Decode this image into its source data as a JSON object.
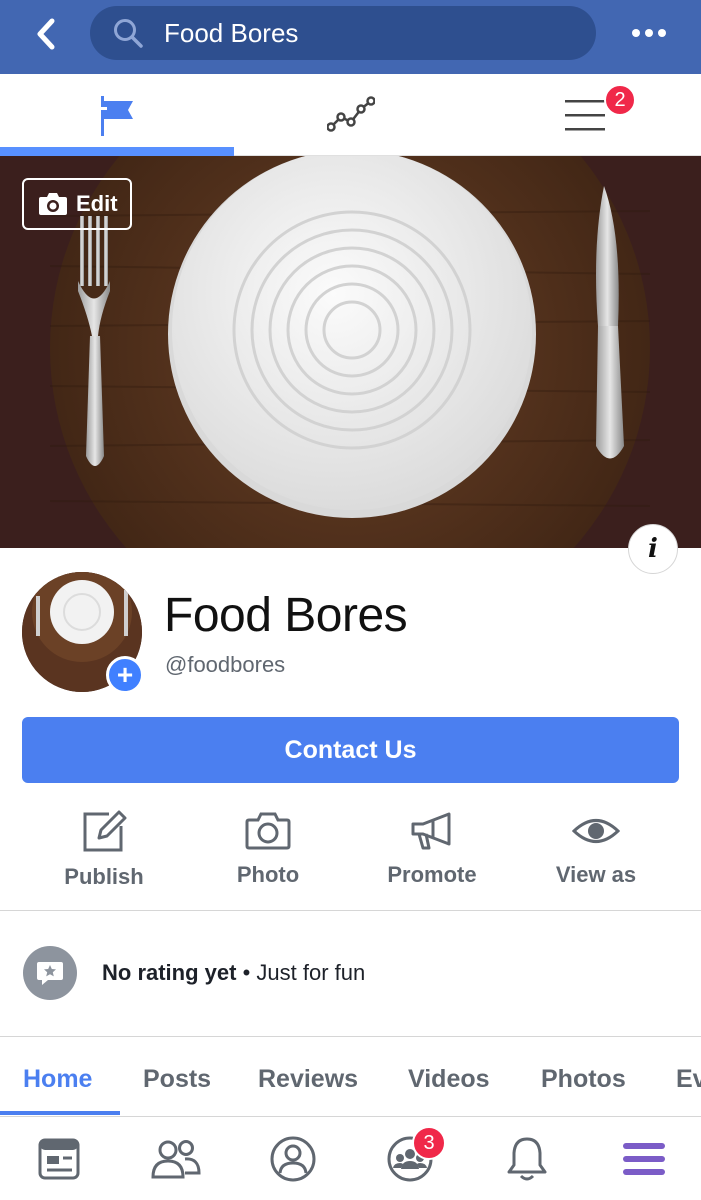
{
  "topbar": {
    "search_value": "Food Bores",
    "icons": {
      "back": "chevron-left-icon",
      "search": "search-icon",
      "more": "more-dots-icon"
    },
    "color": "#4267b2"
  },
  "admin_tabs": {
    "items": [
      {
        "name": "page",
        "icon": "flag-icon",
        "active": true
      },
      {
        "name": "insights",
        "icon": "insights-line-icon",
        "active": false
      },
      {
        "name": "menu",
        "icon": "hamburger-icon",
        "badge": "2",
        "active": false
      }
    ]
  },
  "cover": {
    "edit_label": "Edit",
    "edit_icon": "camera-icon",
    "info_icon": "info-icon"
  },
  "profile": {
    "name": "Food Bores",
    "handle": "@foodbores",
    "add_icon": "plus-icon"
  },
  "cta": {
    "label": "Contact Us",
    "color": "#4b7ff0"
  },
  "actions": [
    {
      "label": "Publish",
      "icon": "compose-icon"
    },
    {
      "label": "Photo",
      "icon": "camera-icon"
    },
    {
      "label": "Promote",
      "icon": "megaphone-icon"
    },
    {
      "label": "View as",
      "icon": "eye-icon"
    }
  ],
  "rating": {
    "main": "No rating yet",
    "separator": " • ",
    "sub": "Just for fun",
    "icon": "star-speech-bubble-icon"
  },
  "page_tabs": [
    {
      "label": "Home",
      "active": true
    },
    {
      "label": "Posts"
    },
    {
      "label": "Reviews"
    },
    {
      "label": "Videos"
    },
    {
      "label": "Photos"
    },
    {
      "label": "Ev"
    }
  ],
  "bottom_nav": {
    "items": [
      {
        "icon": "news-feed-icon"
      },
      {
        "icon": "friends-icon"
      },
      {
        "icon": "profile-icon"
      },
      {
        "icon": "groups-icon",
        "badge": "3"
      },
      {
        "icon": "bell-icon"
      },
      {
        "icon": "menu-icon",
        "color": "#7b5cc7"
      }
    ]
  }
}
